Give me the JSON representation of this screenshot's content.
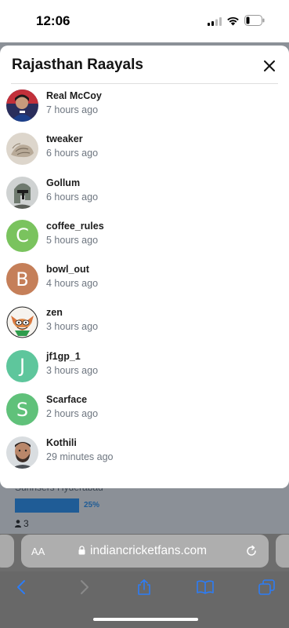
{
  "status": {
    "time": "12:06"
  },
  "modal": {
    "title": "Rajasthan Raayals",
    "users": [
      {
        "name": "Real McCoy",
        "time": "7 hours ago",
        "avatar": "photo",
        "icon": "cricketer-avatar-icon"
      },
      {
        "name": "tweaker",
        "time": "6 hours ago",
        "avatar": "photo",
        "icon": "hands-avatar-icon"
      },
      {
        "name": "Gollum",
        "time": "6 hours ago",
        "avatar": "photo",
        "icon": "helmet-avatar-icon"
      },
      {
        "name": "coffee_rules",
        "time": "5 hours ago",
        "avatar": "letter",
        "letter": "C",
        "color": "#7ac35e"
      },
      {
        "name": "bowl_out",
        "time": "4 hours ago",
        "avatar": "letter",
        "letter": "B",
        "color": "#c57f59"
      },
      {
        "name": "zen",
        "time": "3 hours ago",
        "avatar": "photo",
        "icon": "cartoon-fox-avatar-icon"
      },
      {
        "name": "jf1gp_1",
        "time": "3 hours ago",
        "avatar": "letter",
        "letter": "J",
        "color": "#5ec69c"
      },
      {
        "name": "Scarface",
        "time": "2 hours ago",
        "avatar": "letter",
        "letter": "S",
        "color": "#60c17a"
      },
      {
        "name": "Kothili",
        "time": "29 minutes ago",
        "avatar": "photo",
        "icon": "face-avatar-icon"
      }
    ]
  },
  "background": {
    "team_text": "Sunrisers Hyderabad",
    "percent": "25%",
    "percent_value": 25,
    "count": "3"
  },
  "browser": {
    "aa_label": "AA",
    "url": "indiancricketfans.com"
  },
  "colors": {
    "accent": "#1f5c96",
    "safari_blue": "#2c7cf6"
  }
}
